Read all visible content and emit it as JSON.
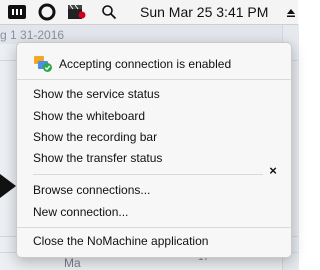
{
  "menubar": {
    "clock": "Sun Mar 25  3:41 PM",
    "icons": [
      "nomachine-icon",
      "circle-icon",
      "clapper-icon",
      "search-icon",
      "eject-icon"
    ]
  },
  "background": {
    "date_fragment": "g 1  31-2016",
    "bottom_fragment": "Ma",
    "bottom_number": "17"
  },
  "menu": {
    "status_item": "Accepting connection is enabled",
    "group1": [
      "Show the service status",
      "Show the whiteboard",
      "Show the recording bar",
      "Show the transfer status"
    ],
    "group2": [
      "Browse connections...",
      "New connection..."
    ],
    "quit": "Close the NoMachine application",
    "close_glyph": "×"
  }
}
